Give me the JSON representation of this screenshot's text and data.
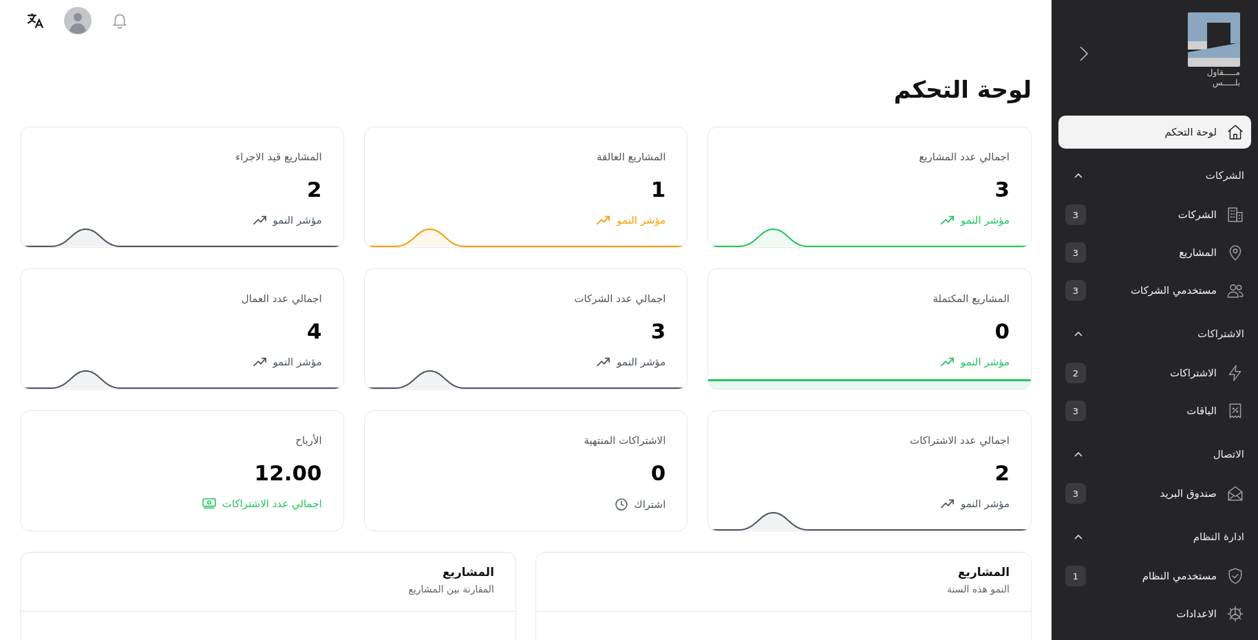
{
  "page_title": "لوحة التحكم",
  "stat_cards": [
    {
      "title": "اجمالي عدد المشاريع",
      "value": "3",
      "trend_text": "مؤشر النمو",
      "kind": "growth",
      "color": "#22c55e"
    },
    {
      "title": "المشاريع العالقة",
      "value": "1",
      "trend_text": "مؤشر النمو",
      "kind": "growth",
      "color": "#f59e0b"
    },
    {
      "title": "المشاريع قيد الاجراء",
      "value": "2",
      "trend_text": "مؤشر النمو",
      "kind": "growth",
      "color": "#4b5563"
    },
    {
      "title": "المشاريع المكتملة",
      "value": "0",
      "trend_text": "مؤشر النمو",
      "kind": "complete",
      "color": "#22c55e"
    },
    {
      "title": "اجمالي عدد الشركات",
      "value": "3",
      "trend_text": "مؤشر النمو",
      "kind": "growth",
      "color": "#4b5563"
    },
    {
      "title": "اجمالي عدد العمال",
      "value": "4",
      "trend_text": "مؤشر النمو",
      "kind": "growth",
      "color": "#4b5563"
    },
    {
      "title": "اجمالي عدد الاشتراكات",
      "value": "2",
      "trend_text": "مؤشر النمو",
      "kind": "growth",
      "color": "#4b5563"
    },
    {
      "title": "الاشتراكات المنتهية",
      "value": "0",
      "trend_text": "اشتراك",
      "kind": "expiry",
      "color": "#4b5563"
    },
    {
      "title": "الأرباح",
      "value": "12.00",
      "trend_text": "اجمالي عدد الاشتراكات",
      "kind": "revenue",
      "color": "#22c55e"
    }
  ],
  "panels": [
    {
      "title": "المشاريع",
      "subtitle": "النمو هذه السنة"
    },
    {
      "title": "المشاريع",
      "subtitle": "المقارنة بين المشاريع"
    }
  ],
  "sidebar": {
    "logo_lines": [
      "مـــــقاول",
      "بلـــــس"
    ],
    "dashboard": {
      "label": "لوحة التحكم",
      "selected": true
    },
    "groups": [
      {
        "label": "الشركات",
        "expanded": true,
        "items": [
          {
            "label": "الشركات",
            "badge": "3",
            "selected": false
          },
          {
            "label": "المشاريع",
            "badge": "3",
            "selected": false
          },
          {
            "label": "مستخدمي الشركات",
            "badge": "3",
            "selected": false
          }
        ]
      },
      {
        "label": "الاشتراكات",
        "expanded": true,
        "items": [
          {
            "label": "الاشتراكات",
            "badge": "2",
            "selected": false
          },
          {
            "label": "الباقات",
            "badge": "3",
            "selected": false
          }
        ]
      },
      {
        "label": "الاتصال",
        "expanded": true,
        "items": [
          {
            "label": "صندوق البريد",
            "badge": "3",
            "selected": false
          }
        ]
      },
      {
        "label": "ادارة النظام",
        "expanded": true,
        "items": [
          {
            "label": "مستخدمي النظام",
            "badge": "1",
            "selected": false
          },
          {
            "label": "الاعدادات",
            "selected": false
          }
        ]
      }
    ]
  }
}
